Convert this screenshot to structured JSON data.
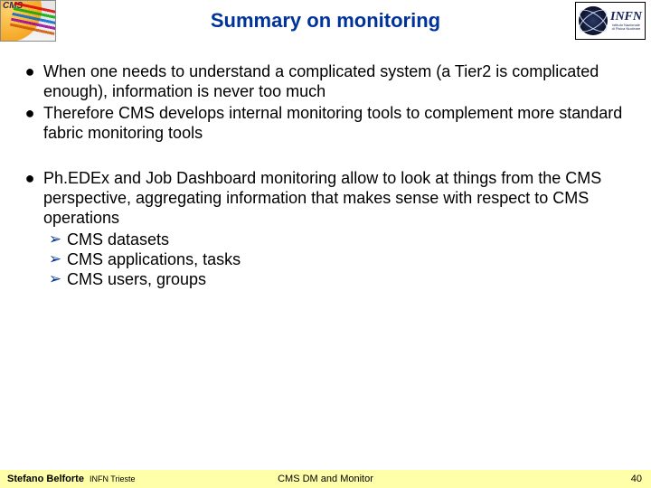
{
  "header": {
    "title": "Summary on monitoring",
    "logo_left_label": "CMS",
    "logo_right_big": "INFN",
    "logo_right_small1": "Istituto Nazionale",
    "logo_right_small2": "di Fisica Nucleare"
  },
  "bullets": {
    "group1": [
      "When one needs to understand a complicated system (a Tier2 is complicated enough), information is never too much",
      "Therefore CMS develops internal monitoring tools to complement more standard fabric monitoring tools"
    ],
    "group2": [
      "Ph.EDEx and Job Dashboard monitoring allow to look at things from the CMS perspective, aggregating information that makes sense with respect to CMS operations"
    ],
    "group2_sub": [
      "CMS datasets",
      "CMS applications, tasks",
      "CMS users, groups"
    ]
  },
  "footer": {
    "author": "Stefano Belforte",
    "affiliation": "INFN Trieste",
    "center": "CMS DM and Monitor",
    "page": "40"
  }
}
